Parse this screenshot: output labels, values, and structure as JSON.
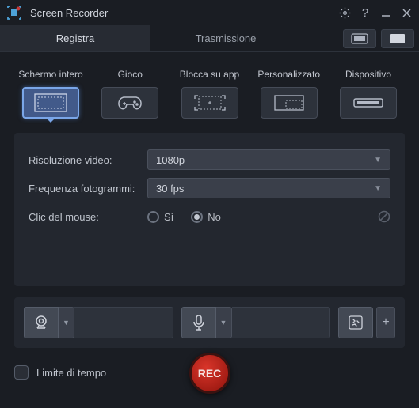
{
  "app": {
    "title": "Screen Recorder"
  },
  "tabs": {
    "record": "Registra",
    "stream": "Trasmissione"
  },
  "modes": {
    "fullscreen": "Schermo intero",
    "game": "Gioco",
    "lockapp": "Blocca su app",
    "custom": "Personalizzato",
    "device": "Dispositivo"
  },
  "settings": {
    "resolution_label": "Risoluzione video:",
    "resolution_value": "1080p",
    "fps_label": "Frequenza fotogrammi:",
    "fps_value": "30 fps",
    "mouseclick_label": "Clic del mouse:",
    "yes": "Sì",
    "no": "No",
    "mouseclick_selected": "no"
  },
  "bottom": {
    "timelimit_label": "Limite di tempo",
    "rec_label": "REC"
  }
}
